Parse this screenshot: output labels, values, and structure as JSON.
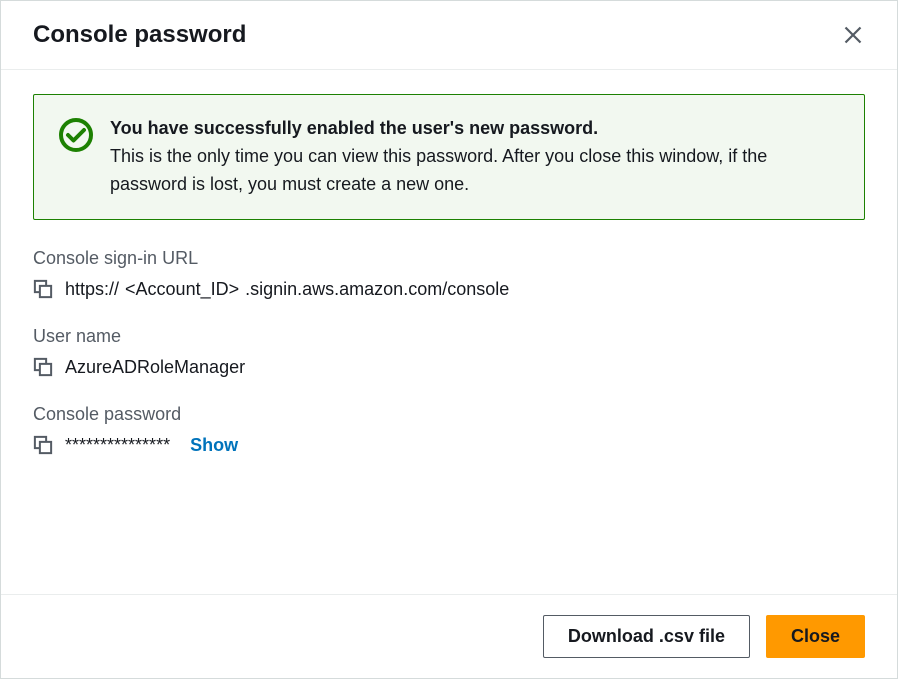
{
  "header": {
    "title": "Console password"
  },
  "alert": {
    "title": "You have successfully enabled the user's new password.",
    "body": "This is the only time you can view this password. After you close this window, if the password is lost, you must create a new one."
  },
  "fields": {
    "signin_url": {
      "label": "Console sign-in URL",
      "prefix": "https://",
      "account_placeholder": "<Account_ID>",
      "suffix": ".signin.aws.amazon.com/console"
    },
    "username": {
      "label": "User name",
      "value": "AzureADRoleManager"
    },
    "password": {
      "label": "Console password",
      "masked": "***************",
      "show_label": "Show"
    }
  },
  "footer": {
    "download_label": "Download .csv file",
    "close_label": "Close"
  }
}
